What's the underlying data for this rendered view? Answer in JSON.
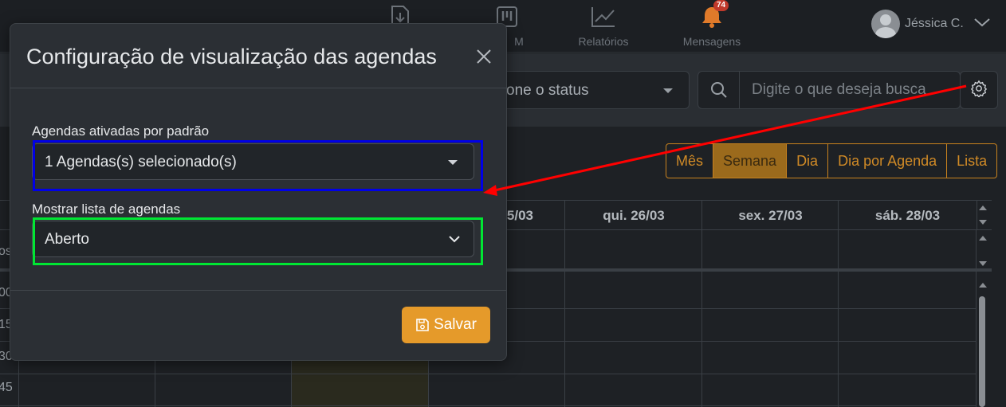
{
  "nav": {
    "items": [
      {
        "label": "",
        "icon": "download-icon"
      },
      {
        "label": "M",
        "icon": "kanban-icon"
      },
      {
        "label": "Relatórios",
        "icon": "chart-line-icon"
      },
      {
        "label": "Mensagens",
        "icon": "bell-icon",
        "badge": "74"
      }
    ],
    "user": {
      "name": "Jéssica C."
    }
  },
  "filters": {
    "status_text": "one o status",
    "search_placeholder": "Digite o que deseja busca"
  },
  "views": [
    "Mês",
    "Semana",
    "Dia",
    "Dia por Agenda",
    "Lista"
  ],
  "active_view": "Semana",
  "calendar": {
    "columns": [
      "5/03",
      "qui. 26/03",
      "sex. 27/03",
      "sáb. 28/03"
    ],
    "all_day_label": "os",
    "times": [
      "00",
      "15",
      "30",
      "45"
    ]
  },
  "modal": {
    "title": "Configuração de visualização das agendas",
    "fields": [
      {
        "label": "Agendas ativadas por padrão",
        "value": "1 Agendas(s) selecionado(s)"
      },
      {
        "label": "Mostrar lista de agendas",
        "value": "Aberto"
      }
    ],
    "save_label": "Salvar"
  },
  "colors": {
    "accent": "#e59a2a",
    "highlight_blue": "#0000e6",
    "highlight_green": "#00e633",
    "arrow": "#ff0000",
    "badge": "#c0392b"
  }
}
